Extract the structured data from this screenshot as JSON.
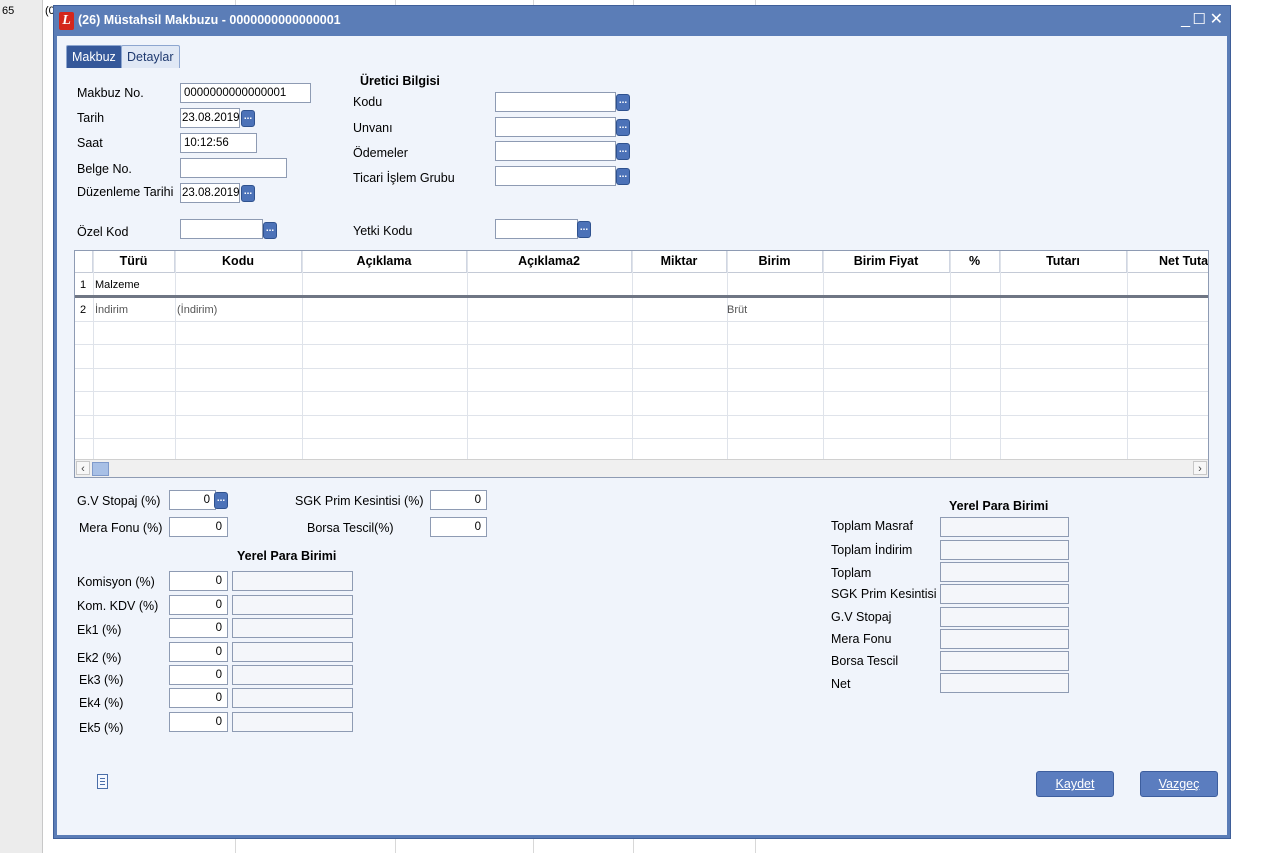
{
  "background": {
    "cells": [
      "65",
      "(0"
    ]
  },
  "window": {
    "title": "(26) Müstahsil Makbuzu - 0000000000000001",
    "icon": "logo-l-icon",
    "controls": {
      "minimize": "_",
      "maximize": "☐",
      "close": "✕"
    }
  },
  "tabs": [
    {
      "label": "Makbuz",
      "active": true
    },
    {
      "label": "Detaylar",
      "active": false
    }
  ],
  "form": {
    "makbuz_no": {
      "label": "Makbuz No.",
      "value": "0000000000000001"
    },
    "tarih": {
      "label": "Tarih",
      "value": "23.08.2019"
    },
    "saat": {
      "label": "Saat",
      "value": "10:12:56"
    },
    "belge_no": {
      "label": "Belge No.",
      "value": ""
    },
    "duzenleme_tarihi": {
      "label": "Düzenleme Tarihi",
      "value": "23.08.2019"
    },
    "ozel_kod": {
      "label": "Özel Kod",
      "value": ""
    },
    "yetki_kodu": {
      "label": "Yetki Kodu",
      "value": ""
    }
  },
  "uretici": {
    "title": "Üretici Bilgisi",
    "kodu": {
      "label": "Kodu",
      "value": ""
    },
    "unvani": {
      "label": "Unvanı",
      "value": ""
    },
    "odemeler": {
      "label": "Ödemeler",
      "value": ""
    },
    "ticari_islem_grubu": {
      "label": "Ticari İşlem Grubu",
      "value": ""
    }
  },
  "grid": {
    "columns": [
      "Türü",
      "Kodu",
      "Açıklama",
      "Açıklama2",
      "Miktar",
      "Birim",
      "Birim Fiyat",
      "%",
      "Tutarı",
      "Net Tuta"
    ],
    "rows": [
      {
        "num": "1",
        "turu": "Malzeme",
        "kodu": "",
        "birim": ""
      },
      {
        "num": "2",
        "turu": "İndirim",
        "kodu": "(İndirim)",
        "birim": "Brüt"
      }
    ]
  },
  "kesintiler": {
    "gv_stopaj": {
      "label": "G.V Stopaj (%)",
      "value": "0"
    },
    "mera_fonu": {
      "label": "Mera Fonu (%)",
      "value": "0"
    },
    "sgk_prim": {
      "label": "SGK Prim Kesintisi (%)",
      "value": "0"
    },
    "borsa_tescil": {
      "label": "Borsa Tescil(%)",
      "value": "0"
    }
  },
  "komisyon": {
    "title": "Yerel Para Birimi",
    "items": [
      {
        "label": "Komisyon (%)",
        "value": "0",
        "amount": ""
      },
      {
        "label": "Kom. KDV (%)",
        "value": "0",
        "amount": ""
      },
      {
        "label": "Ek1 (%)",
        "value": "0",
        "amount": ""
      },
      {
        "label": "Ek2 (%)",
        "value": "0",
        "amount": ""
      },
      {
        "label": "Ek3 (%)",
        "value": "0",
        "amount": ""
      },
      {
        "label": "Ek4 (%)",
        "value": "0",
        "amount": ""
      },
      {
        "label": "Ek5 (%)",
        "value": "0",
        "amount": ""
      }
    ]
  },
  "totals": {
    "title": "Yerel Para Birimi",
    "items": [
      {
        "label": "Toplam Masraf",
        "value": ""
      },
      {
        "label": "Toplam İndirim",
        "value": ""
      },
      {
        "label": "Toplam",
        "value": ""
      },
      {
        "label": "SGK Prim Kesintisi",
        "value": ""
      },
      {
        "label": "G.V Stopaj",
        "value": ""
      },
      {
        "label": "Mera Fonu",
        "value": ""
      },
      {
        "label": "Borsa Tescil",
        "value": ""
      },
      {
        "label": "Net",
        "value": ""
      }
    ]
  },
  "buttons": {
    "save": "Kaydet",
    "cancel": "Vazgeç"
  },
  "colors": {
    "title_bar": "#5b7db7",
    "client_bg": "#f0f4fb",
    "button_bg": "#5b7dbf",
    "active_tab": "#35589a"
  }
}
